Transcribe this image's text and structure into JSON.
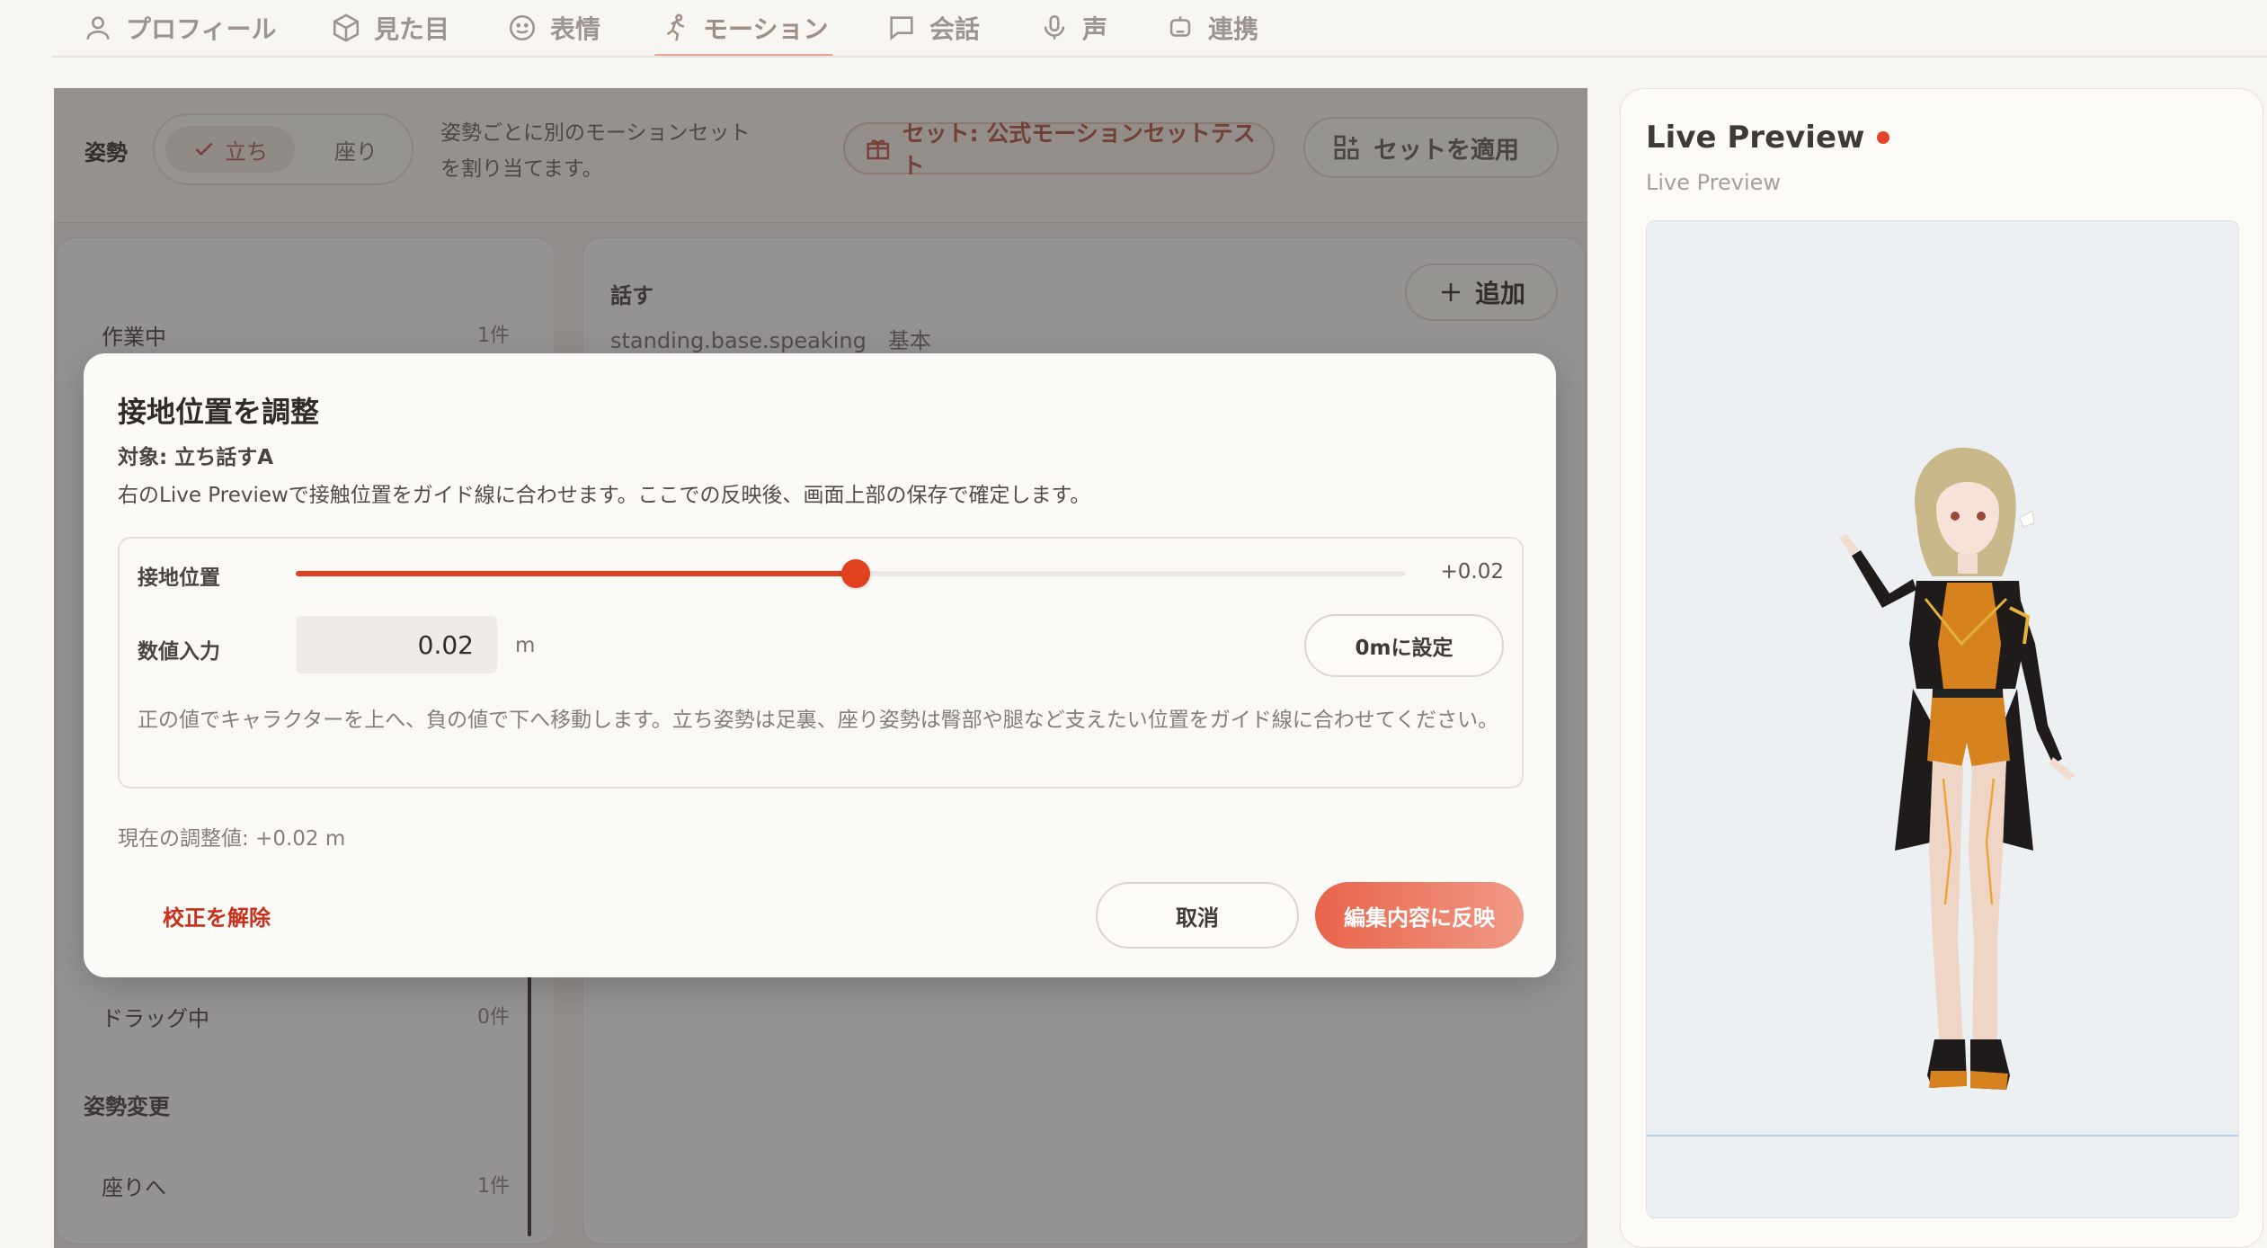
{
  "nav": {
    "tabs": [
      {
        "label": "プロフィール",
        "icon": "user-icon"
      },
      {
        "label": "見た目",
        "icon": "cube-icon"
      },
      {
        "label": "表情",
        "icon": "smile-icon"
      },
      {
        "label": "モーション",
        "icon": "running-icon",
        "active": true
      },
      {
        "label": "会話",
        "icon": "chat-icon"
      },
      {
        "label": "声",
        "icon": "mic-icon"
      },
      {
        "label": "連携",
        "icon": "robot-icon"
      }
    ]
  },
  "posture": {
    "label": "姿勢",
    "options": [
      {
        "label": "立ち",
        "selected": true
      },
      {
        "label": "座り",
        "selected": false
      }
    ],
    "description": "姿勢ごとに別のモーションセットを割り当てます。",
    "set_badge": "セット: 公式モーションセットテスト",
    "apply_set_button": "セットを適用"
  },
  "left_panel": {
    "items": [
      {
        "label": "作業中",
        "count": "1件"
      },
      {
        "label": "ドラッグ中",
        "count": "0件"
      }
    ],
    "section": "姿勢変更",
    "section_items": [
      {
        "label": "座りへ",
        "count": "1件"
      }
    ]
  },
  "right_panel": {
    "title": "話す",
    "subtitle": "standing.base.speaking　基本",
    "add_button": "追加"
  },
  "preview": {
    "title": "Live Preview",
    "subtitle": "Live Preview",
    "status_color": "#e4452a"
  },
  "modal": {
    "title": "接地位置を調整",
    "target": "対象: 立ち話すA",
    "description": "右のLive Previewで接触位置をガイド線に合わせます。ここでの反映後、画面上部の保存で確定します。",
    "slider_label": "接地位置",
    "slider_value_text": "+0.02",
    "slider_fraction": 0.505,
    "numeric_label": "数値入力",
    "numeric_value": "0.02",
    "unit": "m",
    "zero_button": "0mに設定",
    "hint": "正の値でキャラクターを上へ、負の値で下へ移動します。立ち姿勢は足裏、座り姿勢は臀部や腿など支えたい位置をガイド線に合わせてください。",
    "current": "現在の調整値: +0.02 m",
    "reset_button": "校正を解除",
    "cancel_button": "取消",
    "apply_button": "編集内容に反映"
  },
  "colors": {
    "accent": "#e0421f",
    "danger": "#c9301c",
    "overlay": "#282624"
  }
}
